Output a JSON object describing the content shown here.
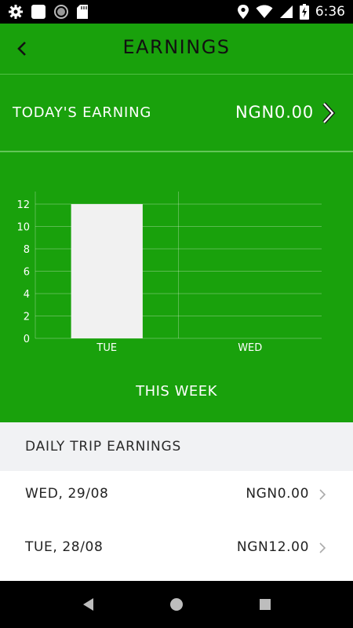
{
  "status_bar": {
    "time": "6:36",
    "icons": [
      "settings-icon",
      "white-square-icon",
      "record-icon",
      "sd-card-icon",
      "location-icon",
      "wifi-icon",
      "signal-icon",
      "battery-charging-icon"
    ]
  },
  "header": {
    "title": "EARNINGS",
    "back_icon": "chevron-left-icon"
  },
  "today": {
    "label": "TODAY'S EARNING",
    "value": "NGN0.00"
  },
  "chart_data": {
    "type": "bar",
    "title": "",
    "xlabel": "",
    "ylabel": "",
    "categories": [
      "TUE",
      "WED"
    ],
    "values": [
      12,
      0
    ],
    "ylim": [
      0,
      12
    ],
    "yticks": [
      0,
      2,
      4,
      6,
      8,
      10,
      12
    ],
    "grid": true,
    "bar_color": "#f1f1f1"
  },
  "chart_caption": "THIS WEEK",
  "daily": {
    "title": "DAILY TRIP EARNINGS",
    "rows": [
      {
        "date": "WED, 29/08",
        "amount": "NGN0.00"
      },
      {
        "date": "TUE, 28/08",
        "amount": "NGN12.00"
      }
    ]
  },
  "colors": {
    "primary_green": "#19a10c",
    "section_bg": "#f1f2f4"
  }
}
